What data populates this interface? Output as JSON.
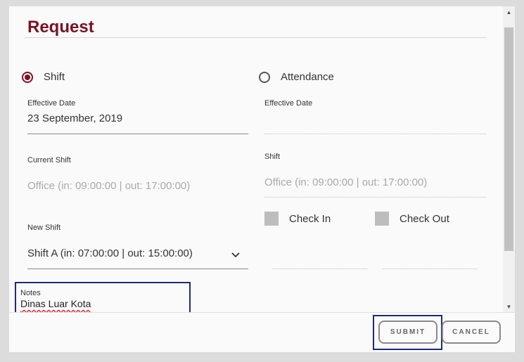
{
  "dialog": {
    "title": "Request"
  },
  "request_type": {
    "options": [
      {
        "label": "Shift",
        "selected": true
      },
      {
        "label": "Attendance",
        "selected": false
      }
    ]
  },
  "shift_section": {
    "effective_date_label": "Effective Date",
    "effective_date_value": "23 September, 2019",
    "current_shift_label": "Current Shift",
    "current_shift_value": "Office (in: 09:00:00 | out: 17:00:00)",
    "new_shift_label": "New Shift",
    "new_shift_value": "Shift A (in: 07:00:00 | out: 15:00:00)"
  },
  "attendance_section": {
    "effective_date_label": "Effective Date",
    "effective_date_value": "",
    "shift_label": "Shift",
    "shift_value": "Office (in: 09:00:00 | out: 17:00:00)",
    "check_in_label": "Check In",
    "check_out_label": "Check Out"
  },
  "notes": {
    "label": "Notes",
    "value": "Dinas Luar Kota"
  },
  "buttons": {
    "submit": "SUBMIT",
    "cancel": "CANCEL"
  },
  "colors": {
    "accent": "#7a1324",
    "highlight_border": "#1f2a7a",
    "checkbox_fill": "#bdbdbd"
  },
  "icons": {
    "dropdown": "chevron-down-icon",
    "scroll_up": "scroll-up-arrow-icon",
    "scroll_down": "scroll-down-arrow-icon"
  }
}
